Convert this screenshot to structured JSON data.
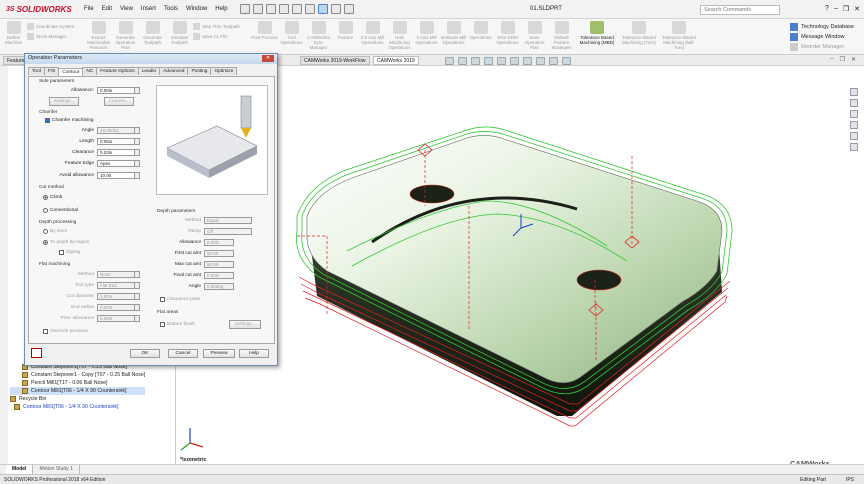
{
  "app": {
    "brand": "SOLIDWORKS",
    "doc_title": "01.SLDPRT",
    "search_placeholder": "Search Commands"
  },
  "menus": [
    "File",
    "Edit",
    "View",
    "Insert",
    "Tools",
    "Window",
    "Help"
  ],
  "ribbon": {
    "buttons_left": [
      {
        "label": "Define Machine"
      },
      {
        "label": "Coordinate System"
      },
      {
        "label": "Stock Manager"
      }
    ],
    "buttons_mid": [
      {
        "label": "Extract Machinable Features"
      },
      {
        "label": "Generate Operation Plan"
      },
      {
        "label": "Generate Toolpath"
      },
      {
        "label": "Simulate Toolpath"
      }
    ],
    "col2": [
      "Step Thru Toolpath",
      "Save CL File"
    ],
    "buttons_right": [
      {
        "label": "Post Process"
      },
      {
        "label": "Tool Operations"
      },
      {
        "label": "CAMWorks Sync Manager"
      },
      {
        "label": "Feature"
      },
      {
        "label": "2.5 Axis Mill Operations"
      },
      {
        "label": "Hole Machining Operations"
      },
      {
        "label": "3 Axis Mill Operations"
      },
      {
        "label": "Multiaxis Mill Operations"
      },
      {
        "label": "Operations"
      },
      {
        "label": "Wire EDM Operations"
      },
      {
        "label": "Save Operation Plan"
      },
      {
        "label": "Default Feature Strategies"
      }
    ],
    "tolerance": [
      {
        "label": "Tolerance Based Machining (MBD)",
        "active": true
      },
      {
        "label": "Tolerance Based Machining (Turn)",
        "active": false
      },
      {
        "label": "Tolerance Based Machining (Mill-Turn)",
        "active": false
      }
    ],
    "side": [
      "Technology Database",
      "Message Window",
      "Reorder Manager"
    ]
  },
  "doc_tabs": [
    "Feature",
    "CAMWorks 2019-WorkFlow",
    "CAMWorks 2019"
  ],
  "tree": [
    {
      "label": "Constant Stepover1[T07 - 0.25 Ball Nose]",
      "blue": false,
      "sel": false,
      "indent": 1
    },
    {
      "label": "Constant Stepover1 - Copy [T07 - 0.25 Ball Nose]",
      "blue": false,
      "sel": false,
      "indent": 1
    },
    {
      "label": "Pencil Mill1[T17 - 0.06 Ball Nose]",
      "blue": false,
      "sel": false,
      "indent": 1
    },
    {
      "label": "Contour Mill1[T06 - 1/4 X 90 Countersink]",
      "blue": false,
      "sel": true,
      "indent": 1
    },
    {
      "label": "Recycle Bin",
      "blue": false,
      "sel": false,
      "indent": 0
    },
    {
      "label": "Contour Mill1[T06 - 1/4 X 90 Countersink]",
      "blue": true,
      "sel": false,
      "indent": 2
    }
  ],
  "dialog": {
    "title": "Operation Parameters",
    "tabs": [
      "Tool",
      "F/S",
      "Contour",
      "NC",
      "Feature Options",
      "Leadin",
      "Advanced",
      "Posting",
      "Optimize"
    ],
    "active_tab": "Contour",
    "side_params": {
      "group": "Side parameters",
      "allowance_label": "Allowance:",
      "allowance": "0.00in",
      "settings": "Settings...",
      "corners": "Corners..."
    },
    "chamfer": {
      "group": "Chamfer",
      "chk": "Chamfer machining",
      "angle_label": "Angle",
      "angle": "45.00deg",
      "length_label": "Length",
      "length": "0.05in",
      "clearance_label": "Clearance",
      "clearance": "0.03in",
      "edge_label": "Feature Edge",
      "edge": "Apex",
      "avoid_label": "Avoid allowance",
      "avoid": "10.00"
    },
    "cut_method": {
      "group": "Cut method",
      "climb": "Climb",
      "conventional": "Conventional"
    },
    "depth_processing": {
      "group": "Depth processing",
      "by_level": "By level",
      "to_depth": "To depth by region",
      "zigzag": "Zigzag"
    },
    "flat_machining": {
      "group": "Flat machining",
      "method_label": "Method",
      "method": "None",
      "tool_type_label": "Tool type",
      "tool_type": "Flat End",
      "cut_diameter_label": "Cut diameter",
      "cut_diameter": "1.00in",
      "end_radius_label": "End radius",
      "end_radius": "0.00in",
      "prev_allow_label": "Prev. allowance",
      "prev_allow": "0.00in"
    },
    "override": "Override previous",
    "depth_params": {
      "group": "Depth parameters",
      "method_label": "Method",
      "method": "Equal",
      "ramp_label": "Ramp",
      "ramp": "Off",
      "allowance_label": "Allowance",
      "allowance": "0.00in",
      "first_cut_label": "First cut amt",
      "first_cut": "50.00",
      "max_cut_label": "Max cut amt",
      "max_cut": "50.00",
      "final_cut_label": "Final cut amt",
      "final_cut": "0.00in",
      "angle_label": "Angle",
      "angle": "0.00deg",
      "clearance_pass": "Clearance pass"
    },
    "flat_areas": {
      "group": "Flat areas",
      "bottom_finish": "Bottom finish",
      "settings": "Settings..."
    },
    "buttons": {
      "ok": "OK",
      "cancel": "Cancel",
      "preview": "Preview",
      "help": "Help"
    }
  },
  "viewport": {
    "view_label": "*Isometric",
    "watermark": "CAMWorks"
  },
  "bottom_tabs": [
    "Model",
    "Motion Study 1"
  ],
  "status": {
    "left": "SOLIDWORKS Professional 2018 x64 Edition",
    "mode": "Editing Part",
    "units": "IPS"
  }
}
